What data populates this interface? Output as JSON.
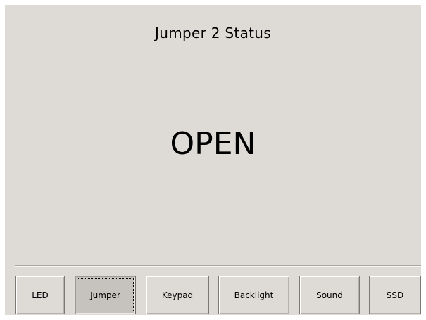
{
  "screen": {
    "title": "Jumper 2 Status",
    "status_value": "OPEN"
  },
  "nav": {
    "active": "Jumper",
    "buttons": [
      {
        "label": "LED"
      },
      {
        "label": "Jumper"
      },
      {
        "label": "Keypad"
      },
      {
        "label": "Backlight"
      },
      {
        "label": "Sound"
      },
      {
        "label": "SSD"
      }
    ]
  },
  "colors": {
    "background": "#dedbd6",
    "active_button": "#c6c3be",
    "text": "#000000"
  }
}
